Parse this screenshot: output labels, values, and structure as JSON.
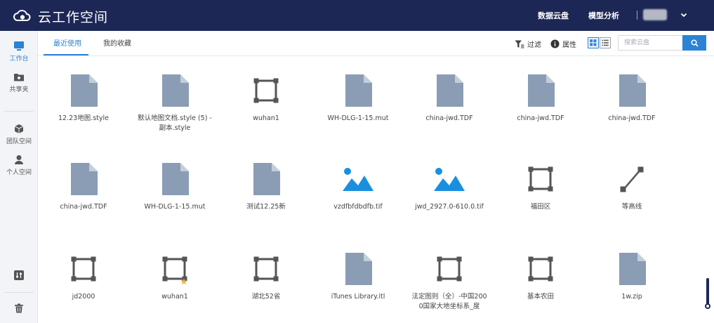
{
  "app": {
    "title": "云工作空间"
  },
  "topnav": {
    "data_cloud": "数据云盘",
    "model_analysis": "模型分析"
  },
  "sidebar": {
    "items": [
      {
        "label": "工作台",
        "icon": "monitor-icon"
      },
      {
        "label": "共享夹",
        "icon": "shared-folder-icon"
      },
      {
        "label": "团队空间",
        "icon": "cube-icon"
      },
      {
        "label": "个人空间",
        "icon": "person-icon"
      }
    ]
  },
  "tabs": {
    "recent": "最近使用",
    "favorites": "我的收藏"
  },
  "toolbar": {
    "filter": "过滤",
    "attributes": "属性",
    "search_placeholder": "搜索云盘"
  },
  "files": [
    {
      "name": "12.23地图.style",
      "icon": "doc-icon"
    },
    {
      "name": "默认地图文档.style (5) -副本.style",
      "icon": "doc-icon"
    },
    {
      "name": "wuhan1",
      "icon": "polygon-icon"
    },
    {
      "name": "WH-DLG-1-15.mut",
      "icon": "doc-icon"
    },
    {
      "name": "china-jwd.TDF",
      "icon": "doc-icon"
    },
    {
      "name": "china-jwd.TDF",
      "icon": "doc-icon"
    },
    {
      "name": "china-jwd.TDF",
      "icon": "doc-icon"
    },
    {
      "name": "china-jwd.TDF",
      "icon": "doc-icon"
    },
    {
      "name": "WH-DLG-1-15.mut",
      "icon": "doc-icon"
    },
    {
      "name": "测试12.25新",
      "icon": "doc-icon"
    },
    {
      "name": "vzdfbfdbdfb.tif",
      "icon": "image-icon"
    },
    {
      "name": "jwd_2927.0-610.0.tif",
      "icon": "image-icon"
    },
    {
      "name": "福田区",
      "icon": "polygon-icon"
    },
    {
      "name": "等高线",
      "icon": "line-icon"
    },
    {
      "name": "jd2000",
      "icon": "polygon-icon"
    },
    {
      "name": "wuhan1",
      "icon": "polygon-icon"
    },
    {
      "name": "湖北52省",
      "icon": "polygon-icon"
    },
    {
      "name": "iTunes Library.itl",
      "icon": "doc-icon"
    },
    {
      "name": "法定图则（全）-中国2000国家大地坐标系_度",
      "icon": "polygon-icon"
    },
    {
      "name": "基本农田",
      "icon": "polygon-icon"
    },
    {
      "name": "1w.zip",
      "icon": "doc-icon"
    }
  ],
  "colors": {
    "topbar": "#1d2756",
    "accent": "#2c82d4",
    "doc": "#8a9db5",
    "image": "#1a8fe0",
    "vector": "#555555"
  }
}
